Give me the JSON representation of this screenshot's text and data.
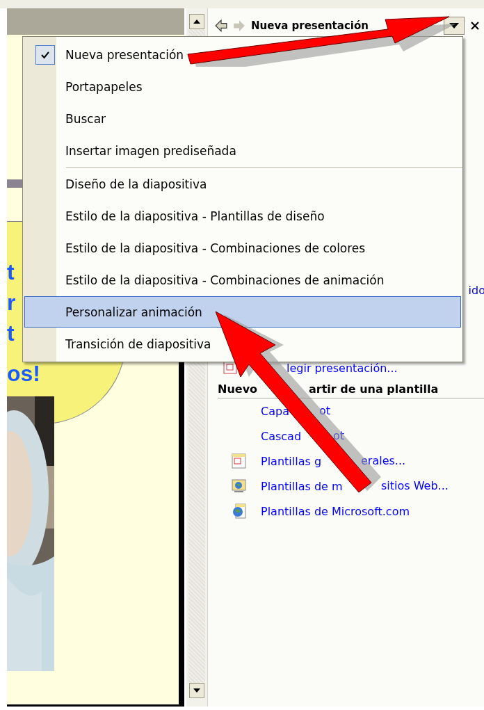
{
  "slide": {
    "cloud_text": [
      "t",
      "r",
      "t",
      "os!"
    ],
    "photo": {
      "kind": "picture"
    }
  },
  "task_pane": {
    "title": "Nueva presentación",
    "link_fragment": "ido",
    "open_link": "legir presentación...",
    "section_title": [
      "Nuevo",
      "artir de una plantilla"
    ],
    "template_links": [
      {
        "parts": [
          "Capa",
          "ot"
        ],
        "kind": "plain"
      },
      {
        "parts": [
          "Cascad",
          "ot"
        ],
        "kind": "plain"
      },
      {
        "parts": [
          "Plantillas g",
          "erales..."
        ],
        "kind": "general"
      },
      {
        "parts": [
          "Plantillas de m",
          "sitios Web..."
        ],
        "kind": "web"
      },
      {
        "parts": [
          "Plantillas de Microsoft.com"
        ],
        "kind": "online"
      }
    ]
  },
  "menu": {
    "groups": [
      [
        {
          "label": "Nueva presentación",
          "checked": true,
          "selected": false
        },
        {
          "label": "Portapapeles",
          "checked": false,
          "selected": false
        },
        {
          "label": "Buscar",
          "checked": false,
          "selected": false
        },
        {
          "label": "Insertar imagen prediseñada",
          "checked": false,
          "selected": false
        }
      ],
      [
        {
          "label": "Diseño de la diapositiva",
          "checked": false,
          "selected": false
        },
        {
          "label": "Estilo de la diapositiva - Plantillas de diseño",
          "checked": false,
          "selected": false
        },
        {
          "label": "Estilo de la diapositiva - Combinaciones de colores",
          "checked": false,
          "selected": false
        },
        {
          "label": "Estilo de la diapositiva - Combinaciones de animación",
          "checked": false,
          "selected": false
        },
        {
          "label": "Personalizar animación",
          "checked": false,
          "selected": true
        },
        {
          "label": "Transición de diapositiva",
          "checked": false,
          "selected": false
        }
      ]
    ]
  }
}
